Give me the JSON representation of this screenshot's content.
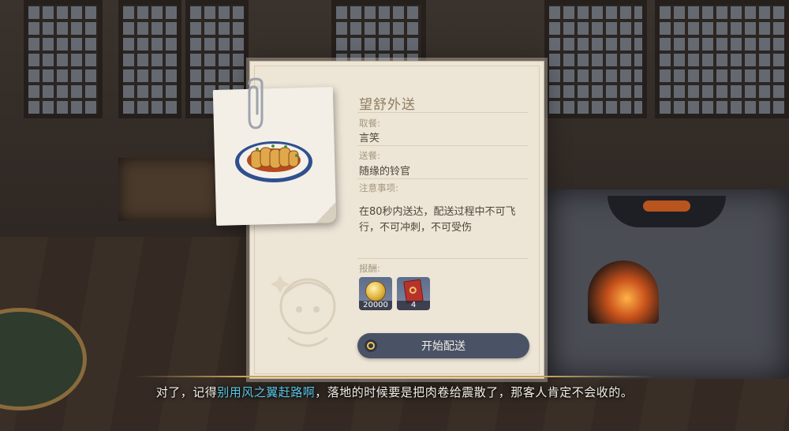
{
  "panel": {
    "title": "望舒外送",
    "pickup_label": "取餐:",
    "pickup_value": "言笑",
    "deliver_label": "送餐:",
    "deliver_value": "随缘的铃官",
    "notes_label": "注意事项:",
    "notes_text": "在80秒内送达，配送过程中不可飞行，不可冲刺，不可受伤",
    "rewards_label": "报酬:",
    "rewards": [
      {
        "icon": "mora-coin-icon",
        "quantity": "20000"
      },
      {
        "icon": "red-card-icon",
        "quantity": "4"
      }
    ],
    "start_button_label": "开始配送"
  },
  "subtitle": {
    "prefix": "对了，记得",
    "highlight": "别用风之翼赶路啊",
    "suffix": "，落地的时候要是把肉卷给震散了，那客人肯定不会收的。",
    "highlight_color": "#57c6e6"
  },
  "colors": {
    "panel_bg": "#ede5d6",
    "button_bg": "#4a5366",
    "title_color": "#8f7d62"
  }
}
